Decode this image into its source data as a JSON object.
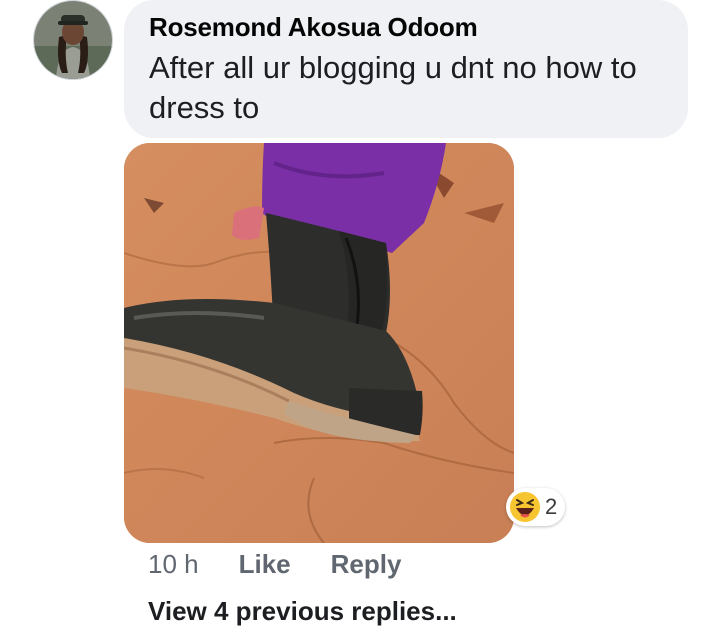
{
  "comment": {
    "author": "Rosemond Akosua Odoom",
    "text": "After all ur blogging u dnt no how to dress to",
    "timestamp": "10 h",
    "like_label": "Like",
    "reply_label": "Reply"
  },
  "reaction": {
    "icon": "haha-emoji-icon",
    "count": "2"
  },
  "view_replies_label": "View 4 previous replies...",
  "colors": {
    "bubble": "#eff1f4",
    "meta_text": "#606770",
    "emoji_yellow": "#f7c52f"
  }
}
